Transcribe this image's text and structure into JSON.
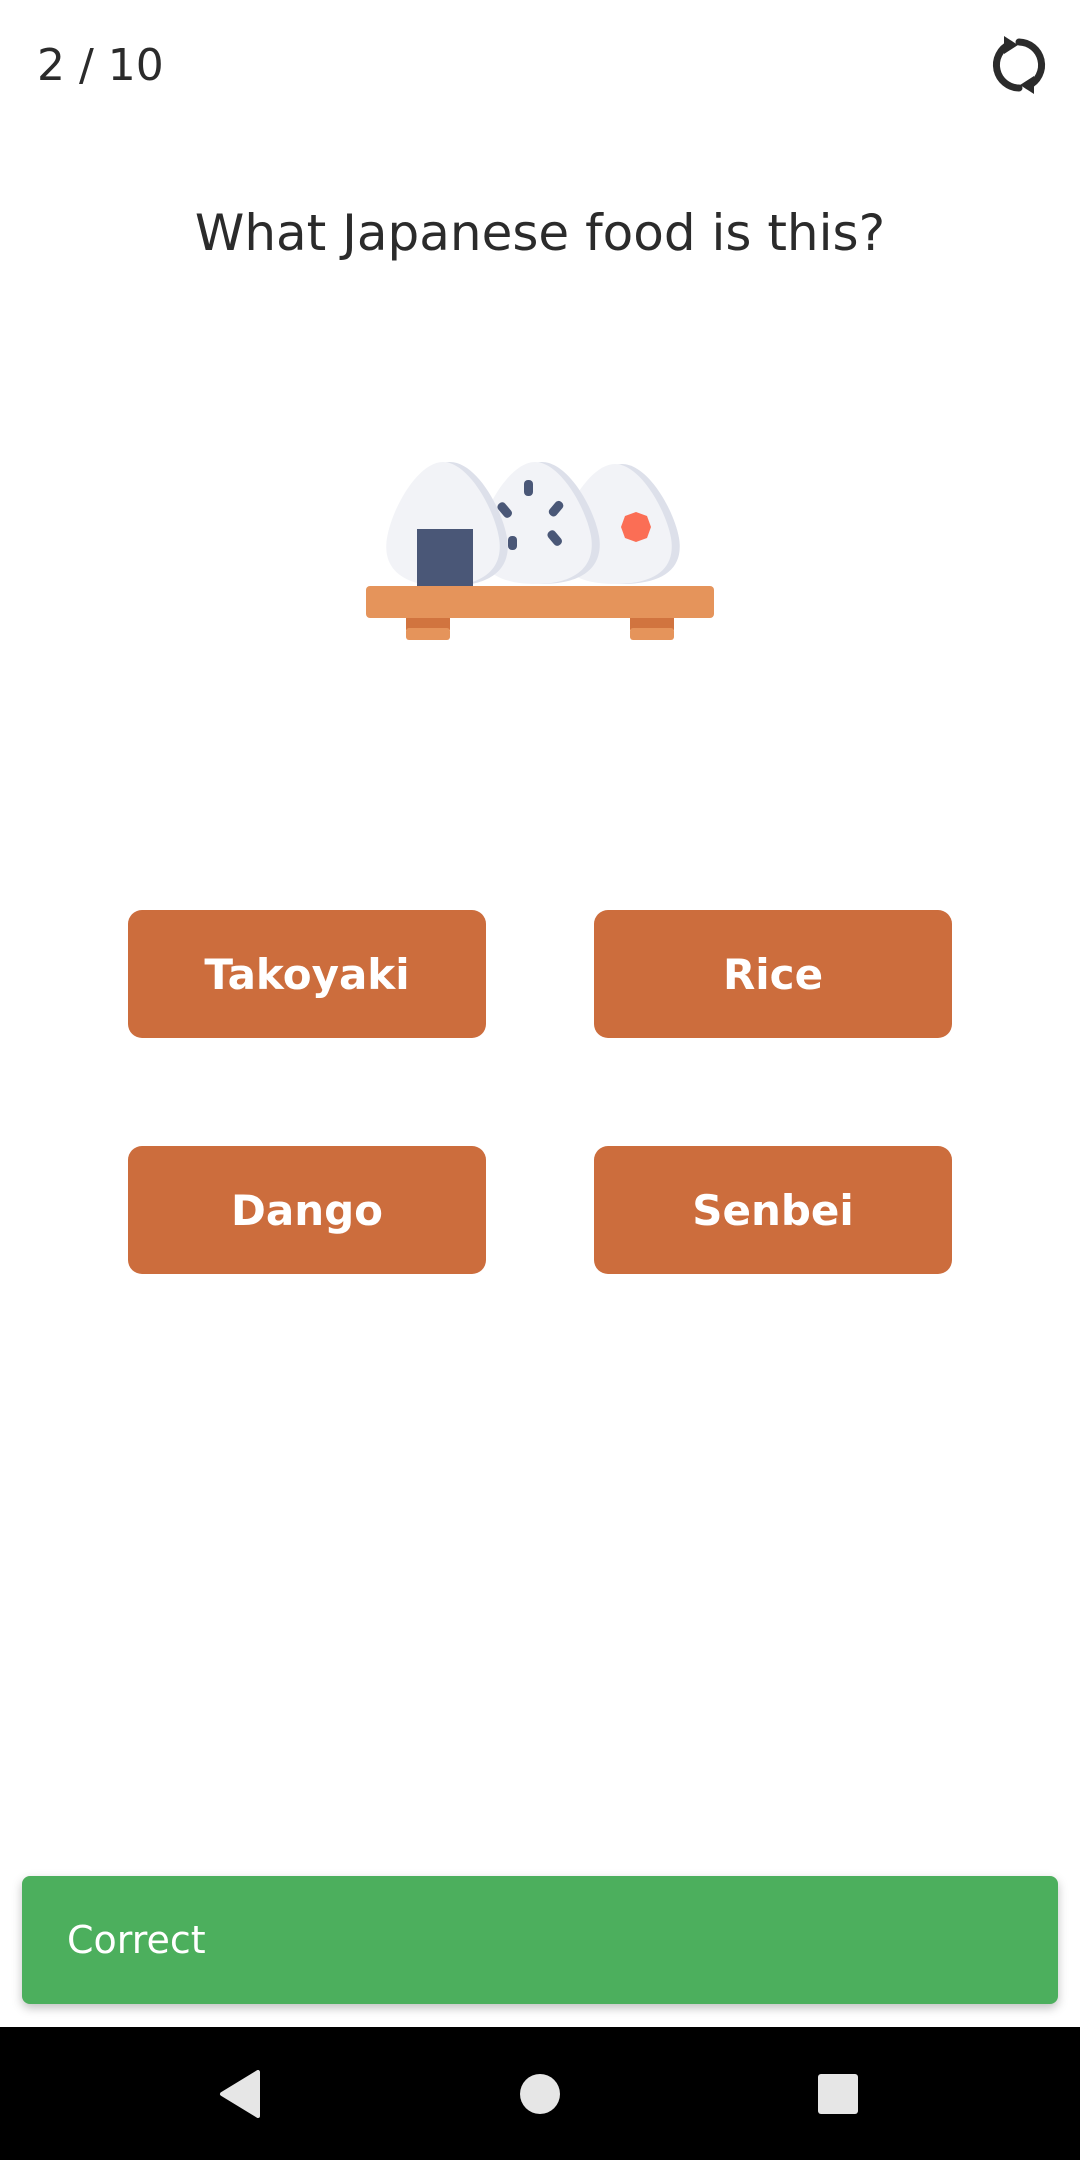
{
  "header": {
    "progress": "2 / 10",
    "restart_icon": "refresh-icon"
  },
  "question": {
    "text": "What Japanese food is this?",
    "image_icon": "onigiri-illustration"
  },
  "answers": [
    {
      "label": "Takoyaki"
    },
    {
      "label": "Rice"
    },
    {
      "label": "Dango"
    },
    {
      "label": "Senbei"
    }
  ],
  "snackbar": {
    "message": "Correct"
  },
  "navigation_bar": {
    "back_icon": "back-triangle-icon",
    "home_icon": "home-circle-icon",
    "recents_icon": "recents-square-icon"
  },
  "colors": {
    "answer_button": "#cc6d3d",
    "snackbar_success": "#4caf5d",
    "text": "#2b2b2b",
    "navbar": "#000000"
  }
}
